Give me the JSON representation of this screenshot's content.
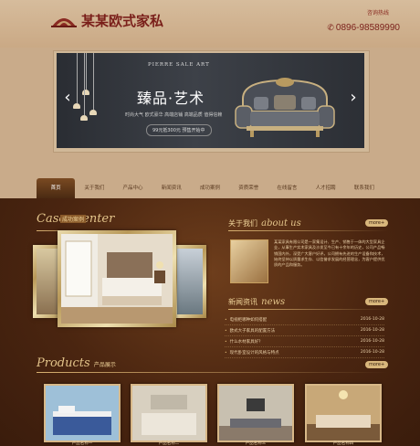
{
  "header": {
    "logo_text": "某某欧式家私",
    "hotline_label": "咨询热线",
    "hotline_phone": "0896-98589990",
    "phone_icon": "phone-icon"
  },
  "banner": {
    "subtitle": "PIERRE SALE ART",
    "title": "臻品·艺术",
    "description": "时尚大气 欧式豪华 高端店铺 高端品质 值得信赖",
    "promo": "99元抵300元 预售开始中",
    "prev_icon": "chevron-left-icon",
    "next_icon": "chevron-right-icon"
  },
  "nav": {
    "items": [
      {
        "label": "首页",
        "active": true
      },
      {
        "label": "关于我们",
        "active": false
      },
      {
        "label": "产品中心",
        "active": false
      },
      {
        "label": "新闻资讯",
        "active": false
      },
      {
        "label": "成功案例",
        "active": false
      },
      {
        "label": "资质荣誉",
        "active": false
      },
      {
        "label": "在线留言",
        "active": false
      },
      {
        "label": "人才招聘",
        "active": false
      },
      {
        "label": "联系我们",
        "active": false
      }
    ]
  },
  "cases": {
    "title_en": "Cases center",
    "title_cn": "成功案例"
  },
  "about": {
    "title_cn": "关于我们",
    "title_en": "about us",
    "more": "more+",
    "text": "某某家具有限公司是一家集设计、生产、销售于一体的大型家具企业，从事生产实木家具及沙发至今已有十余年的历史，公司产品畅销国内外，深受广大客户好评。公司拥有先进的生产设备和技术，始终坚持以质量求生存、以信誉求发展的经营理念，为客户提供优质的产品和服务。"
  },
  "news": {
    "title_cn": "新闻资讯",
    "title_en": "news",
    "more": "more+",
    "items": [
      {
        "title": "电视柜哪种如何搭配",
        "date": "2016-10-28"
      },
      {
        "title": "欧式大子家具的配置方法",
        "date": "2016-10-28"
      },
      {
        "title": "什么水材家具好？",
        "date": "2016-10-28"
      },
      {
        "title": "现代卧室设计的风格与特点",
        "date": "2016-10-28"
      }
    ]
  },
  "products": {
    "title_en": "Products",
    "title_cn": "产品展示",
    "more": "more+",
    "items": [
      {
        "label": "产品名称一"
      },
      {
        "label": "产品名称二"
      },
      {
        "label": "产品名称三"
      },
      {
        "label": "产品名称四"
      }
    ]
  },
  "colors": {
    "brand": "#7a1f1a",
    "accent": "#d8b070",
    "content_bg": "#4a2510"
  }
}
